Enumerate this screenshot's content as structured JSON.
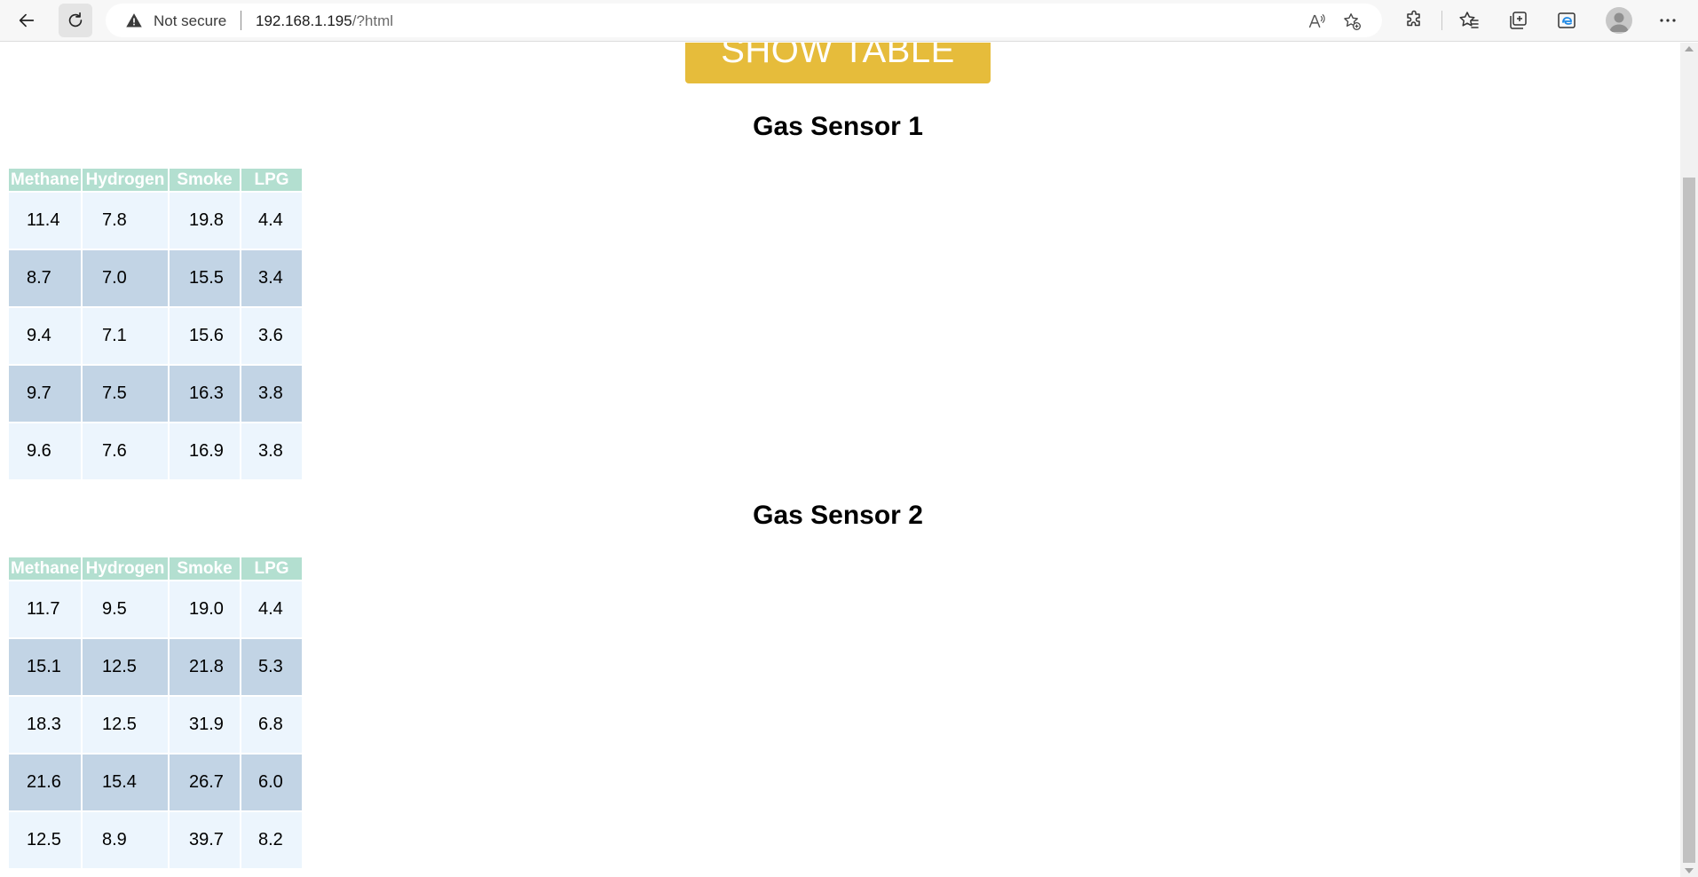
{
  "browser": {
    "security_label": "Not secure",
    "url_host": "192.168.1.195",
    "url_path": "/?html"
  },
  "page": {
    "show_table_button": "SHOW TABLE",
    "colors": {
      "button": "#e6bc3b",
      "header_bg": "#b3dfd0",
      "row_light": "#ecf5fd",
      "row_dark": "#c2d4e5"
    }
  },
  "sensors": [
    {
      "title": "Gas Sensor 1",
      "headers": [
        "Methane",
        "Hydrogen",
        "Smoke",
        "LPG"
      ],
      "rows": [
        [
          "11.4",
          "7.8",
          "19.8",
          "4.4"
        ],
        [
          "8.7",
          "7.0",
          "15.5",
          "3.4"
        ],
        [
          "9.4",
          "7.1",
          "15.6",
          "3.6"
        ],
        [
          "9.7",
          "7.5",
          "16.3",
          "3.8"
        ],
        [
          "9.6",
          "7.6",
          "16.9",
          "3.8"
        ]
      ]
    },
    {
      "title": "Gas Sensor 2",
      "headers": [
        "Methane",
        "Hydrogen",
        "Smoke",
        "LPG"
      ],
      "rows": [
        [
          "11.7",
          "9.5",
          "19.0",
          "4.4"
        ],
        [
          "15.1",
          "12.5",
          "21.8",
          "5.3"
        ],
        [
          "18.3",
          "12.5",
          "31.9",
          "6.8"
        ],
        [
          "21.6",
          "15.4",
          "26.7",
          "6.0"
        ],
        [
          "12.5",
          "8.9",
          "39.7",
          "8.2"
        ]
      ]
    }
  ]
}
